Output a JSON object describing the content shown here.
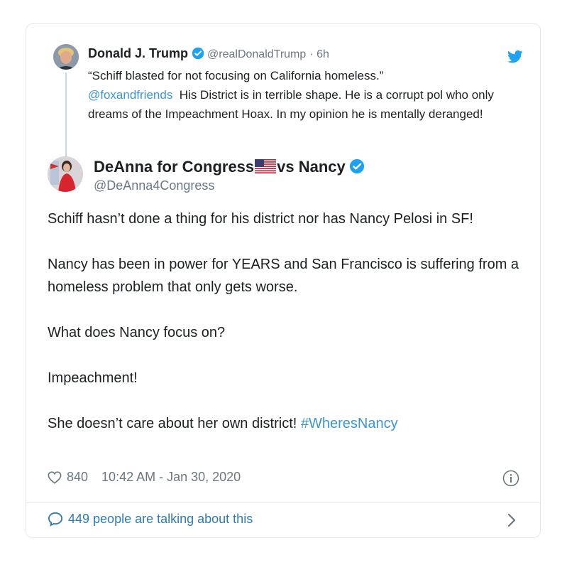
{
  "quoted_tweet": {
    "name": "Donald J. Trump",
    "handle": "@realDonaldTrump",
    "time": "· 6h",
    "quote": "“Schiff blasted for not focusing on California homeless.”",
    "mention": "@foxandfriends",
    "text": "His District is in terrible shape. He is a corrupt pol who only dreams of the Impeachment Hoax. In my opinion he is mentally deranged!"
  },
  "tweet": {
    "name_part1": "DeAnna for Congress",
    "name_part2": "vs Nancy",
    "handle": "@DeAnna4Congress",
    "paragraph_1": "Schiff hasn’t done a thing for his district nor has Nancy Pelosi in SF!",
    "paragraph_2": "Nancy has been in power for YEARS and San Francisco is suffering from a homeless problem that only gets worse.",
    "paragraph_3": "What does Nancy focus on?",
    "paragraph_4": "Impeachment!",
    "paragraph_5": "She doesn’t care about her own district!",
    "hashtag": "#WheresNancy",
    "likes": "840",
    "timestamp": "10:42 AM - Jan 30, 2020"
  },
  "footer": {
    "talking": "449 people are talking about this"
  },
  "colors": {
    "twitter_blue": "#1da1f2",
    "link_blue": "#3b94d9",
    "verified_blue": "#1da1f2",
    "muted_gray": "#697882",
    "border": "#e1e8ed"
  },
  "icons": [
    "twitter-logo-icon",
    "verified-badge-icon",
    "us-flag-icon",
    "heart-icon",
    "info-icon",
    "speech-bubble-icon",
    "chevron-right-icon"
  ]
}
